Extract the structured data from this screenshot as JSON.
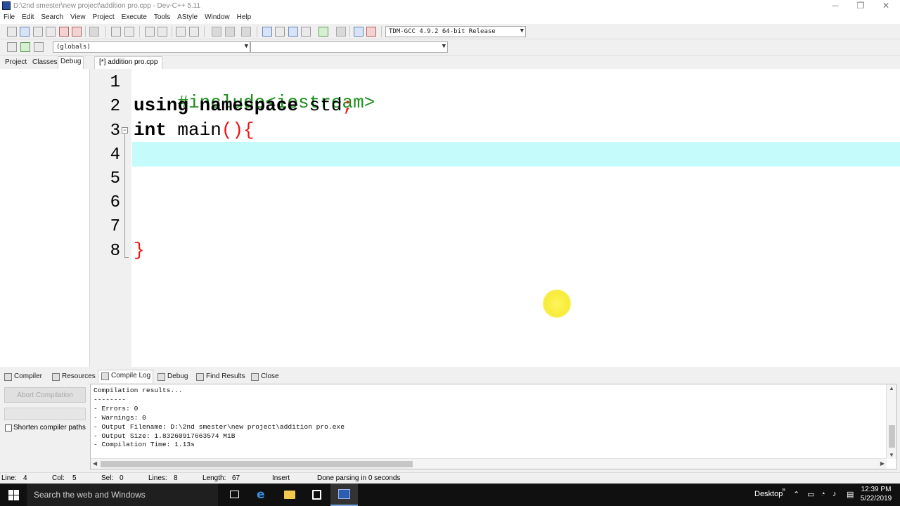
{
  "window": {
    "title": "D:\\2nd smester\\new project\\addition pro.cpp - Dev-C++ 5.11",
    "minimize": "─",
    "restore": "❐",
    "close": "✕"
  },
  "menu": [
    "File",
    "Edit",
    "Search",
    "View",
    "Project",
    "Execute",
    "Tools",
    "AStyle",
    "Window",
    "Help"
  ],
  "toolbar": {
    "compiler_select": "TDM-GCC 4.9.2 64-bit Release",
    "globals_select": "(globals)",
    "members_select": ""
  },
  "left_tabs": [
    "Project",
    "Classes",
    "Debug"
  ],
  "editor": {
    "tab_label": "[*] addition pro.cpp",
    "line_numbers": [
      "1",
      "2",
      "3",
      "4",
      "5",
      "6",
      "7",
      "8"
    ],
    "fold_marker": "−",
    "lines": [
      {
        "pp": "#include<iostream>"
      },
      {
        "kw1": "using",
        "sp1": " ",
        "kw2": "namespace",
        "id": " std",
        "sym": ";"
      },
      {
        "kw": "int",
        "id": " main",
        "sym": "(){"
      },
      {},
      {},
      {},
      {},
      {
        "sym": "}"
      }
    ]
  },
  "bottom_tabs": [
    "Compiler",
    "Resources",
    "Compile Log",
    "Debug",
    "Find Results",
    "Close"
  ],
  "compile_panel": {
    "abort_button": "Abort Compilation",
    "shorten_label": "Shorten compiler paths",
    "shorten_checked": false,
    "log_lines": [
      "Compilation results...",
      "--------",
      "- Errors: 0",
      "- Warnings: 0",
      "- Output Filename: D:\\2nd smester\\new project\\addition pro.exe",
      "- Output Size: 1.83260917663574 MiB",
      "- Compilation Time: 1.13s"
    ]
  },
  "status": {
    "line_label": "Line:",
    "line_value": "4",
    "col_label": "Col:",
    "col_value": "5",
    "sel_label": "Sel:",
    "sel_value": "0",
    "lines_label": "Lines:",
    "lines_value": "8",
    "length_label": "Length:",
    "length_value": "67",
    "mode": "Insert",
    "message": "Done parsing in 0 seconds"
  },
  "taskbar": {
    "search_placeholder": "Search the web and Windows",
    "desktop_label": "Desktop",
    "time": "12:39 PM",
    "date": "5/22/2019"
  },
  "colors": {
    "current_line": "#c6fbfb",
    "preprocessor": "#1a8f1a",
    "symbol": "#e11111",
    "taskbar": "#101010"
  }
}
